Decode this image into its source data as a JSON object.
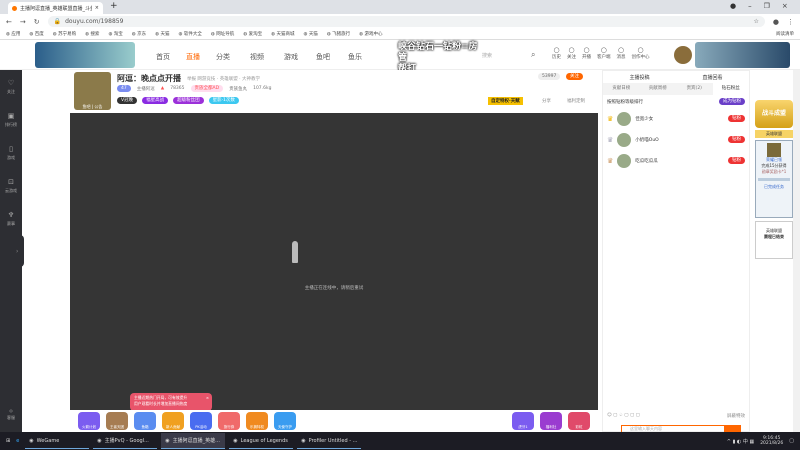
{
  "browser": {
    "tab_title": "主播阿逗直播_英雄联盟直播_斗鱼",
    "url": "douyu.com/198859",
    "bookmarks": [
      "应用",
      "百度",
      "苏宁易购",
      "搜索",
      "淘宝",
      "京东",
      "天猫",
      "软件大全",
      "网址导航",
      "爱淘宝",
      "天猫商城",
      "天猫",
      "飞猪旅行",
      "游戏中心"
    ],
    "reading_list": "阅读清单"
  },
  "header": {
    "nav": [
      "首页",
      "直播",
      "分类",
      "视频",
      "游戏",
      "鱼吧",
      "鱼乐"
    ],
    "search_placeholder": "搜索",
    "icons": [
      "历史",
      "关注",
      "开播",
      "客户端",
      "消息",
      "创作中心"
    ],
    "overlay": [
      "峡谷钻石一钻粉=房管",
      "帮打+VX:douyu198859"
    ]
  },
  "sidebar": {
    "items": [
      "关注",
      "排行榜",
      "游戏",
      "云游戏",
      "赛事"
    ],
    "bottom": "客服"
  },
  "room": {
    "title": "阿逗：晚点点开播",
    "tags": "举报  网游竞技 · 英雄联盟 · 大神教学",
    "level": "47",
    "anchor": "主播阿逗",
    "hot": "78365",
    "badge": "贵族全都AD",
    "fish": "贵族鱼丸",
    "weight": "107.6kg",
    "follows": "53997",
    "follow_btn": "关注",
    "chips": [
      "V冠晚",
      "福星高战",
      "超级粉丝团",
      "星影·1次数"
    ],
    "share": "分享",
    "report": "福利定制",
    "fanlabel": "鱼吧 | 公告",
    "activity": "自定特权·天赋"
  },
  "video": {
    "status": "主播正在连线中，请稍后重试"
  },
  "toast": {
    "line1": "主播近期热门开局，可有效提升",
    "line2": "用户观看时长并增加直播间热度"
  },
  "gifts": [
    "火箭计划",
    "王者天团",
    "鱼箱",
    "新人贡献",
    "PK活动",
    "旅行券",
    "乐拥特权",
    "天使守护",
    "虎牙1",
    "福利社",
    "彩虹"
  ],
  "rank": {
    "tabs_top": [
      "主播投稿",
      "直播回看"
    ],
    "tabs": [
      "贡献日榜",
      "贡献周榜",
      "贵宾(2)",
      "钻石粉丝"
    ],
    "desc": "按照钻粉等级排行",
    "btn": "成为钻粉",
    "users": [
      {
        "name": "佳宽少女",
        "act": "钻粉"
      },
      {
        "name": "小奶喵OuO",
        "act": "钻粉"
      },
      {
        "name": "吃瓜吃瓜瓜",
        "act": "钻粉"
      }
    ],
    "shield": "屏蔽特效",
    "input_placeholder": "这里输入聊天内容"
  },
  "promo": {
    "title": "战斗成盟",
    "tag": "英雄联盟",
    "name": "荣耀已领",
    "task": "完成15分获得",
    "reward": "勋章奖励卡*1",
    "done": "已完成任务",
    "card1": "英雄联盟",
    "card2": "赛程已结束"
  },
  "taskbar": {
    "apps": [
      "WeGame",
      "主播PvQ - Googl...",
      "主播阿逗直播_英雄...",
      "League of Legends",
      "Profiler Untitled - ..."
    ],
    "time": "9:16:45",
    "date": "2021/8/26"
  }
}
